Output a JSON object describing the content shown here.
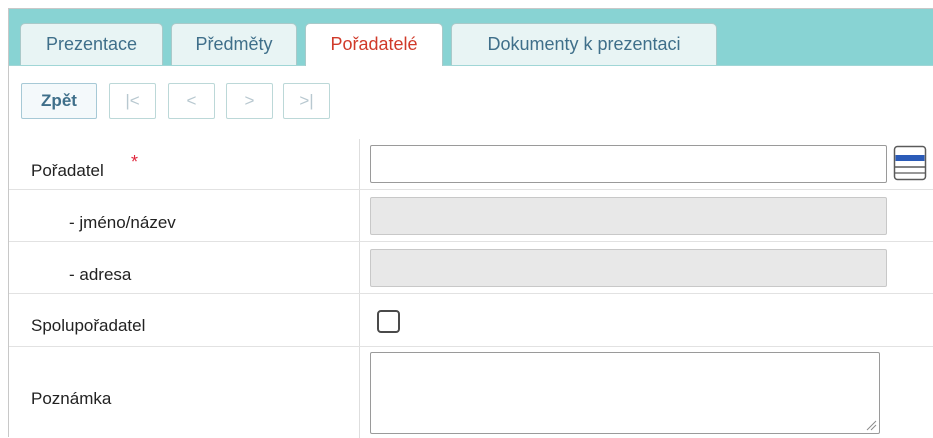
{
  "tabs": [
    {
      "label": "Prezentace",
      "active": false
    },
    {
      "label": "Předměty",
      "active": false
    },
    {
      "label": "Pořadatelé",
      "active": true
    },
    {
      "label": "Dokumenty k prezentaci",
      "active": false
    }
  ],
  "toolbar": {
    "back_label": "Zpět",
    "first_label": "|<",
    "prev_label": "<",
    "next_label": ">",
    "last_label": ">|"
  },
  "form": {
    "poradatel": {
      "label": "Pořadatel",
      "required_mark": "*",
      "value": ""
    },
    "jmeno": {
      "label": "- jméno/název",
      "value": ""
    },
    "adresa": {
      "label": "- adresa",
      "value": ""
    },
    "spoluporadatel": {
      "label": "Spolupořadatel",
      "checked": false
    },
    "poznamka": {
      "label": "Poznámka",
      "value": ""
    }
  },
  "colors": {
    "tab_bar": "#88d3d3",
    "active_tab_text": "#d03a2a",
    "tab_text": "#3f6f8a",
    "required": "#e0253c",
    "picker_blue": "#2b5bb8"
  },
  "icons": {
    "picker": "list-picker-icon",
    "resize": "resize-handle-icon"
  }
}
